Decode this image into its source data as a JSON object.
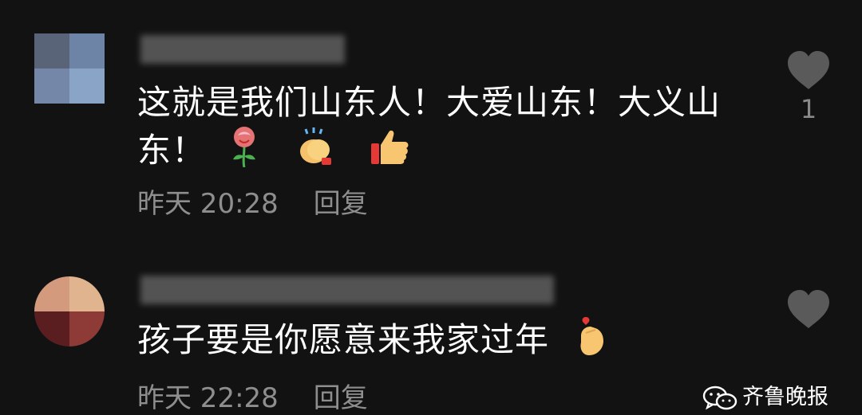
{
  "comments": [
    {
      "text_line1": "这就是我们山东人！大爱山东！大义山",
      "text_line2": "东！",
      "emojis": [
        "rose-icon",
        "clapping-hands-icon",
        "thumbs-up-icon"
      ],
      "time": "昨天 20:28",
      "reply_label": "回复",
      "like_count": "1"
    },
    {
      "text_line1": "孩子要是你愿意来我家过年",
      "emojis": [
        "finger-heart-icon"
      ],
      "time": "昨天 22:28",
      "reply_label": "回复",
      "like_count": ""
    }
  ],
  "watermark": {
    "label": "齐鲁晚报",
    "icon": "wechat-icon"
  },
  "colors": {
    "background": "#121212",
    "text": "#ffffff",
    "meta": "#8e8e8e",
    "heart": "#5a5a5a"
  }
}
